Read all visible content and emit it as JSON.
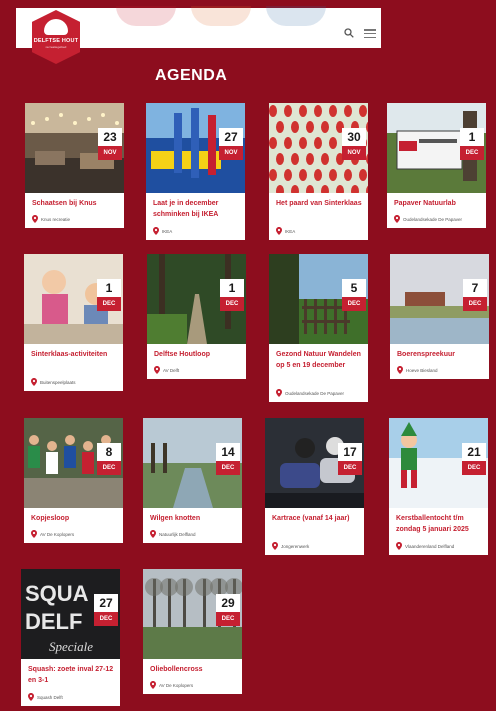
{
  "colors": {
    "background": "#8d0d1e",
    "accent": "#c52031",
    "card": "#ffffff"
  },
  "header": {
    "logo": {
      "name": "DELFTSE HOUT",
      "sub": "recreatiegebied",
      "icon": "tree-logo"
    }
  },
  "page_title": "AGENDA",
  "events": [
    {
      "day": "23",
      "month": "NOV",
      "title": "Schaatsen bij Knus",
      "location": "Knus recreatie",
      "image": "ice-rink-interior"
    },
    {
      "day": "27",
      "month": "NOV",
      "title": "Laat je in december schminken bij IKEA",
      "location": "IKEA",
      "image": "ikea-store"
    },
    {
      "day": "30",
      "month": "NOV",
      "title": "Het paard van Sinterklaas",
      "location": "IKEA",
      "image": "red-pattern"
    },
    {
      "day": "1",
      "month": "DEC",
      "title": "Papaver Natuurlab",
      "location": "Oudelandsekade De Papaver",
      "image": "papaver-sign"
    },
    {
      "day": "1",
      "month": "DEC",
      "title": "Sinterklaas-activiteiten",
      "location": "Buitenspeelplaats",
      "image": "kids-party"
    },
    {
      "day": "1",
      "month": "DEC",
      "title": "Delftse Houtloop",
      "location": "AV Delft",
      "image": "forest-path"
    },
    {
      "day": "5",
      "month": "DEC",
      "title": "Gezond Natuur Wandelen op 5 en 19 december",
      "location": "Oudelandsekade De Papaver",
      "image": "gate-field"
    },
    {
      "day": "7",
      "month": "DEC",
      "title": "Boerenspreekuur",
      "location": "Hoeve Biesland",
      "image": "farm-field"
    },
    {
      "day": "8",
      "month": "DEC",
      "title": "Kopjesloop",
      "location": "AV De Koplopers",
      "image": "runners"
    },
    {
      "day": "14",
      "month": "DEC",
      "title": "Wilgen knotten",
      "location": "Natuurlijk Delfland",
      "image": "willow-canal"
    },
    {
      "day": "17",
      "month": "DEC",
      "title": "Kartrace (vanaf 14 jaar)",
      "location": "Jongerenwerk",
      "image": "go-karts"
    },
    {
      "day": "21",
      "month": "DEC",
      "title": "Kerstballentocht t/m zondag 5 januari 2025",
      "location": "Vlaanderenland Delfland",
      "image": "elf-snow"
    },
    {
      "day": "27",
      "month": "DEC",
      "title": "Squash: zoete inval 27-12 en 3-1",
      "location": "Squash Delft",
      "image": "squash-wall",
      "image_text": [
        "SQUA",
        "DELF",
        "Speciale"
      ]
    },
    {
      "day": "29",
      "month": "DEC",
      "title": "Oliebollencross",
      "location": "AV De Koplopers",
      "image": "winter-field"
    }
  ]
}
